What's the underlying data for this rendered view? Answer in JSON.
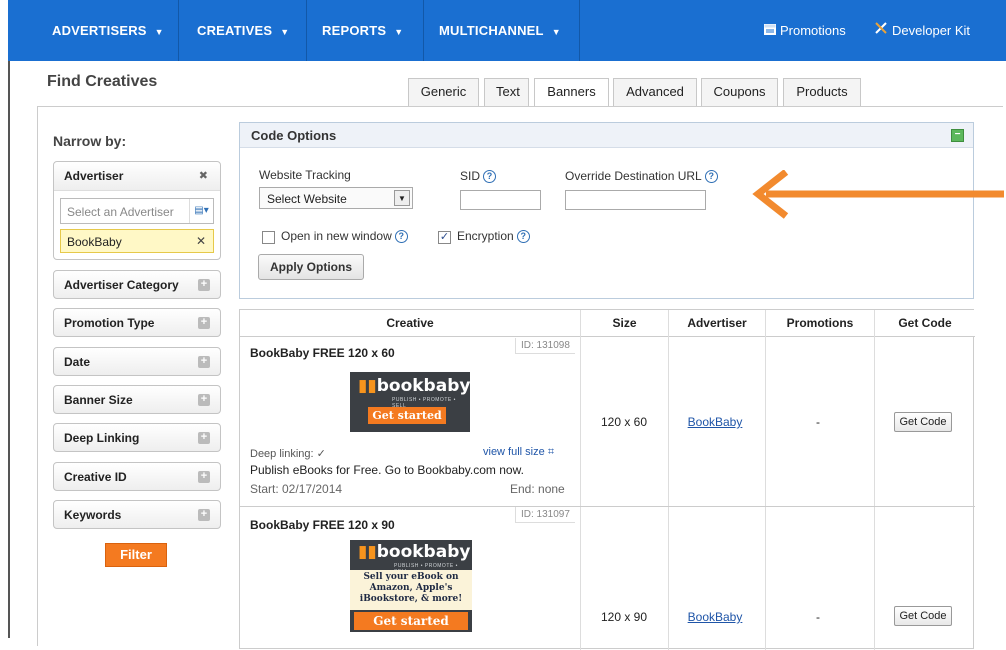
{
  "nav": {
    "items": [
      {
        "label": "ADVERTISERS",
        "caret": "▼"
      },
      {
        "label": "CREATIVES",
        "caret": "▼"
      },
      {
        "label": "REPORTS",
        "caret": "▼"
      },
      {
        "label": "MULTICHANNEL",
        "caret": "▼"
      }
    ],
    "promotions": "Promotions",
    "developer_kit": "Developer Kit"
  },
  "page": {
    "title": "Find Creatives"
  },
  "tabs": [
    {
      "label": "Generic"
    },
    {
      "label": "Text"
    },
    {
      "label": "Banners",
      "active": true
    },
    {
      "label": "Advanced"
    },
    {
      "label": "Coupons"
    },
    {
      "label": "Products"
    }
  ],
  "sidebar": {
    "narrow_by": "Narrow by:",
    "advertiser": {
      "label": "Advertiser",
      "placeholder": "Select an Advertiser",
      "selected": "BookBaby"
    },
    "filters": [
      {
        "label": "Advertiser Category"
      },
      {
        "label": "Promotion Type"
      },
      {
        "label": "Date"
      },
      {
        "label": "Banner Size"
      },
      {
        "label": "Deep Linking"
      },
      {
        "label": "Creative ID"
      },
      {
        "label": "Keywords"
      }
    ],
    "filter_button": "Filter"
  },
  "code_options": {
    "title": "Code Options",
    "website_tracking": "Website Tracking",
    "website_select": "Select Website",
    "sid": "SID",
    "override_url": "Override Destination URL",
    "open_new_window": "Open in new window",
    "open_new_window_checked": false,
    "encryption": "Encryption",
    "encryption_checked": true,
    "apply_button": "Apply Options"
  },
  "table": {
    "headers": {
      "creative": "Creative",
      "size": "Size",
      "advertiser": "Advertiser",
      "promotions": "Promotions",
      "get_code": "Get Code"
    },
    "rows": [
      {
        "title": "BookBaby FREE 120 x 60",
        "id": "ID: 131098",
        "deep_linking": "Deep linking: ✓",
        "view_full": "view full size",
        "description": "Publish eBooks for Free. Go to Bookbaby.com now.",
        "start": "Start: 02/17/2014",
        "end": "End: none",
        "size": "120 x 60",
        "advertiser": "BookBaby",
        "promotions": "-",
        "get_code": "Get Code"
      },
      {
        "title": "BookBaby FREE 120 x 90",
        "id": "ID: 131097",
        "size": "120 x 90",
        "advertiser": "BookBaby",
        "promotions": "-",
        "get_code": "Get Code"
      }
    ]
  },
  "banners": {
    "logo_text": "bookbaby",
    "tagline": "PUBLISH • PROMOTE • SELL",
    "cta": "Get started",
    "message": "Sell your eBook on Amazon, Apple's iBookstore, & more!"
  },
  "colors": {
    "nav_bg": "#1a6fd1",
    "accent_orange": "#f47a20",
    "arrow": "#f28a2e",
    "link": "#1f55a8"
  }
}
